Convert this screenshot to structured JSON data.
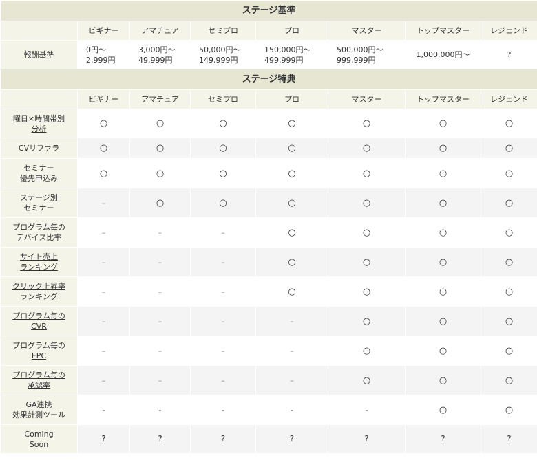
{
  "criteria": {
    "title": "ステージ基準",
    "stages": [
      "ビギナー",
      "アマチュア",
      "セミプロ",
      "プロ",
      "マスター",
      "トップマスター",
      "レジェンド"
    ],
    "row_label": "報酬基準",
    "values": [
      [
        "0円～",
        "2,999円"
      ],
      [
        "3,000円～",
        "49,999円"
      ],
      [
        "50,000円～",
        "149,999円"
      ],
      [
        "150,000円～",
        "499,999円"
      ],
      [
        "500,000円～",
        "999,999円"
      ],
      [
        "1,000,000円～"
      ],
      [
        "?"
      ]
    ]
  },
  "benefits": {
    "title": "ステージ特典",
    "stages": [
      "ビギナー",
      "アマチュア",
      "セミプロ",
      "プロ",
      "マスター",
      "トップマスター",
      "レジェンド"
    ],
    "rows": [
      {
        "label": [
          "曜日×時間帯別",
          "分析"
        ],
        "link": true,
        "cells": [
          "○",
          "○",
          "○",
          "○",
          "○",
          "○",
          "○"
        ]
      },
      {
        "label": [
          "CVリファラ"
        ],
        "link": false,
        "cells": [
          "○",
          "○",
          "○",
          "○",
          "○",
          "○",
          "○"
        ]
      },
      {
        "label": [
          "セミナー",
          "優先申込み"
        ],
        "link": false,
        "cells": [
          "○",
          "○",
          "○",
          "○",
          "○",
          "○",
          "○"
        ]
      },
      {
        "label": [
          "ステージ別",
          "セミナー"
        ],
        "link": false,
        "cells": [
          "–",
          "○",
          "○",
          "○",
          "○",
          "○",
          "○"
        ]
      },
      {
        "label": [
          "プログラム毎の",
          "デバイス比率"
        ],
        "link": false,
        "cells": [
          "–",
          "–",
          "–",
          "○",
          "○",
          "○",
          "○"
        ]
      },
      {
        "label": [
          "サイト売上",
          "ランキング"
        ],
        "link": true,
        "cells": [
          "–",
          "–",
          "–",
          "○",
          "○",
          "○",
          "○"
        ]
      },
      {
        "label": [
          "クリック上昇率",
          "ランキング"
        ],
        "link": true,
        "cells": [
          "–",
          "–",
          "–",
          "○",
          "○",
          "○",
          "○"
        ]
      },
      {
        "label": [
          "プログラム毎の",
          "CVR"
        ],
        "link": true,
        "cells": [
          "–",
          "–",
          "–",
          "–",
          "○",
          "○",
          "○"
        ]
      },
      {
        "label": [
          "プログラム毎の",
          "EPC"
        ],
        "link": true,
        "cells": [
          "–",
          "–",
          "–",
          "–",
          "○",
          "○",
          "○"
        ]
      },
      {
        "label": [
          "プログラム毎の",
          "承認率"
        ],
        "link": true,
        "cells": [
          "–",
          "–",
          "–",
          "–",
          "○",
          "○",
          "○"
        ]
      },
      {
        "label": [
          "GA連携",
          "効果計測ツール"
        ],
        "link": false,
        "cells": [
          "-",
          "-",
          "-",
          "-",
          "-",
          "○",
          "○"
        ]
      },
      {
        "label": [
          "Coming",
          "Soon"
        ],
        "link": false,
        "cells": [
          "?",
          "?",
          "?",
          "?",
          "?",
          "?",
          "?"
        ]
      }
    ]
  }
}
